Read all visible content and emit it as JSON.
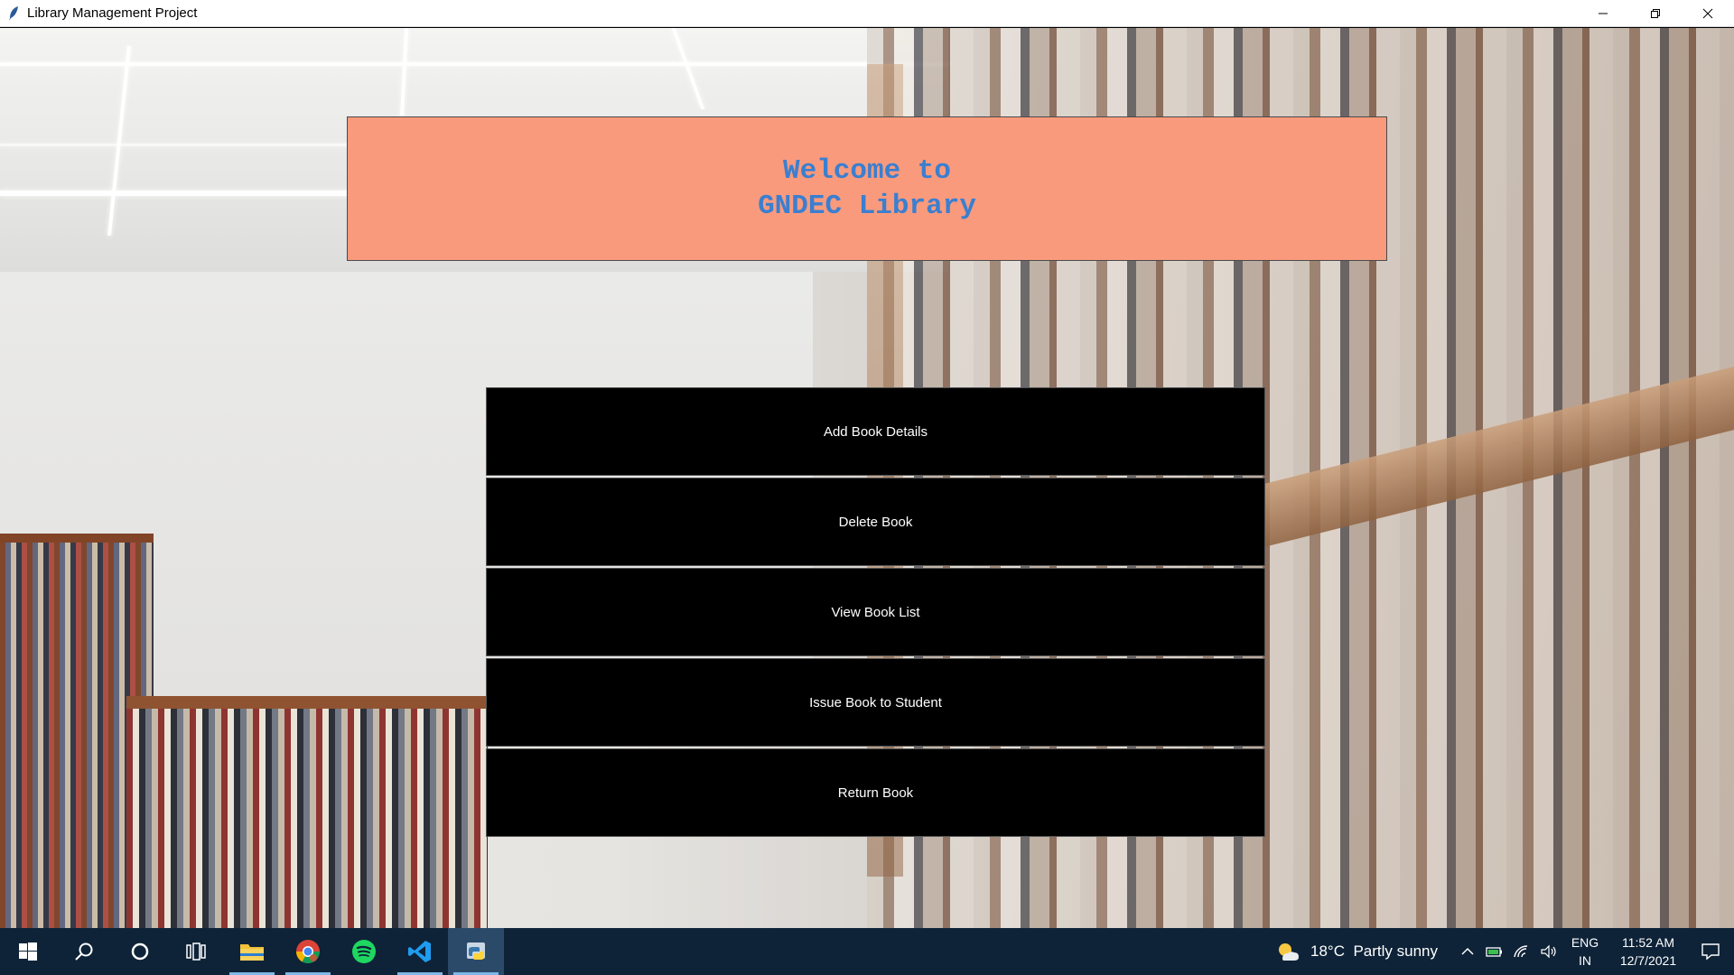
{
  "window": {
    "title": "Library Management Project",
    "controls": [
      "minimize",
      "restore",
      "close"
    ]
  },
  "banner": {
    "line1": "Welcome to",
    "line2": "GNDEC Library",
    "bg_color": "#fa9a7c",
    "text_color": "#3a7fd0"
  },
  "menu": {
    "buttons": [
      {
        "label": "Add Book Details"
      },
      {
        "label": "Delete Book"
      },
      {
        "label": "View Book List"
      },
      {
        "label": "Issue Book to Student"
      },
      {
        "label": "Return Book"
      }
    ],
    "button_color": "#000000",
    "text_color": "#ffffff"
  },
  "taskbar": {
    "apps": [
      "windows-start-icon",
      "search-icon",
      "cortana-icon",
      "task-view-icon",
      "file-explorer-icon",
      "chrome-icon",
      "spotify-icon",
      "vscode-icon",
      "python-icon"
    ],
    "active_app": "python-icon",
    "weather": {
      "temp": "18°C",
      "condition": "Partly sunny"
    },
    "language": {
      "line1": "ENG",
      "line2": "IN"
    },
    "clock": {
      "time": "11:52 AM",
      "date": "12/7/2021"
    }
  }
}
